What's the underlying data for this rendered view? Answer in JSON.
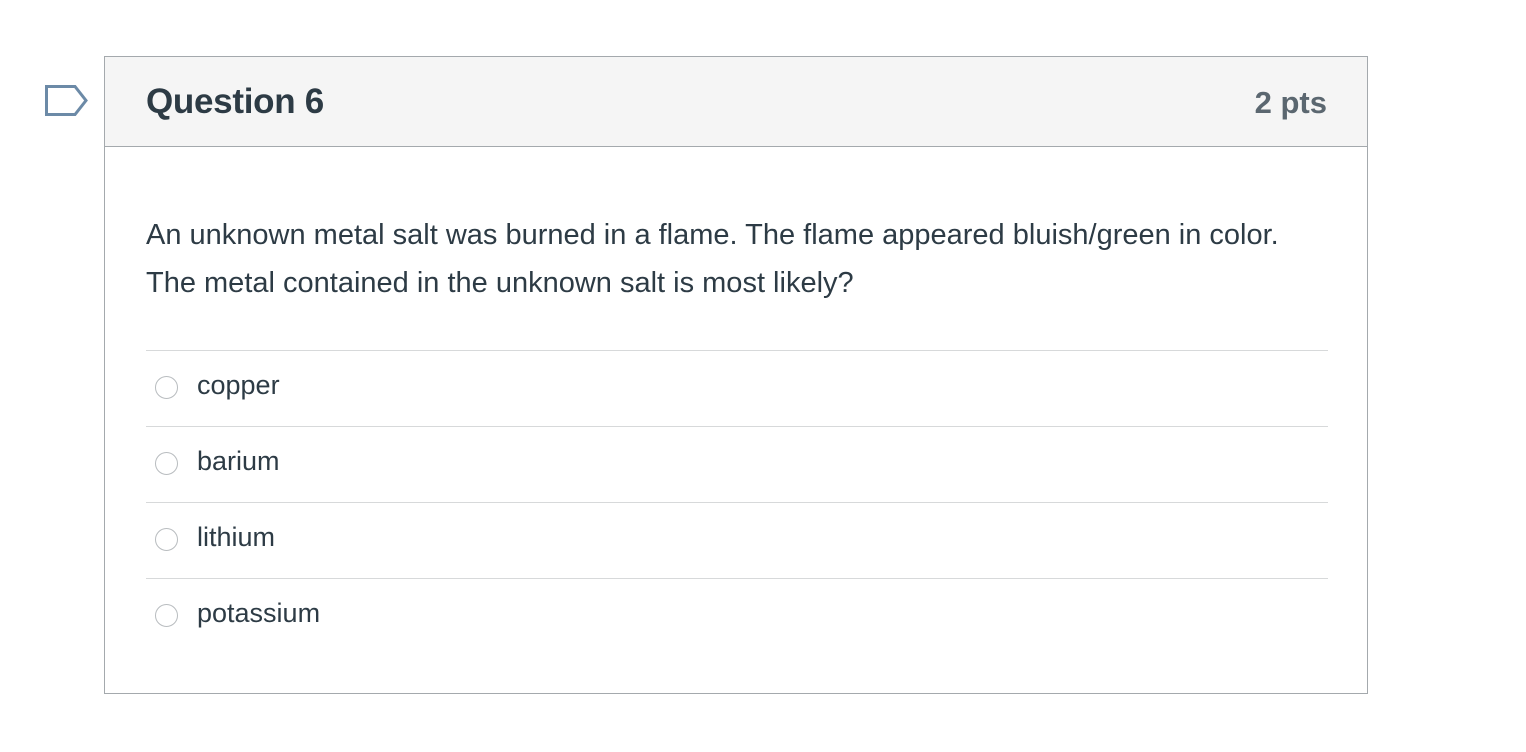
{
  "question": {
    "title": "Question 6",
    "points": "2 pts",
    "text": "An unknown metal salt was burned in a flame.  The flame appeared bluish/green in color.  The metal contained in the unknown salt is most likely?",
    "flag_icon": "flag-question-icon",
    "answers": [
      {
        "label": "copper",
        "selected": false
      },
      {
        "label": "barium",
        "selected": false
      },
      {
        "label": "lithium",
        "selected": false
      },
      {
        "label": "potassium",
        "selected": false
      }
    ]
  },
  "colors": {
    "text": "#2d3b45",
    "points": "#5b6770",
    "header_bg": "#f5f5f5",
    "border": "#a4a9ad",
    "divider": "#d7d9da",
    "flag_stroke": "#6c8aa7"
  }
}
